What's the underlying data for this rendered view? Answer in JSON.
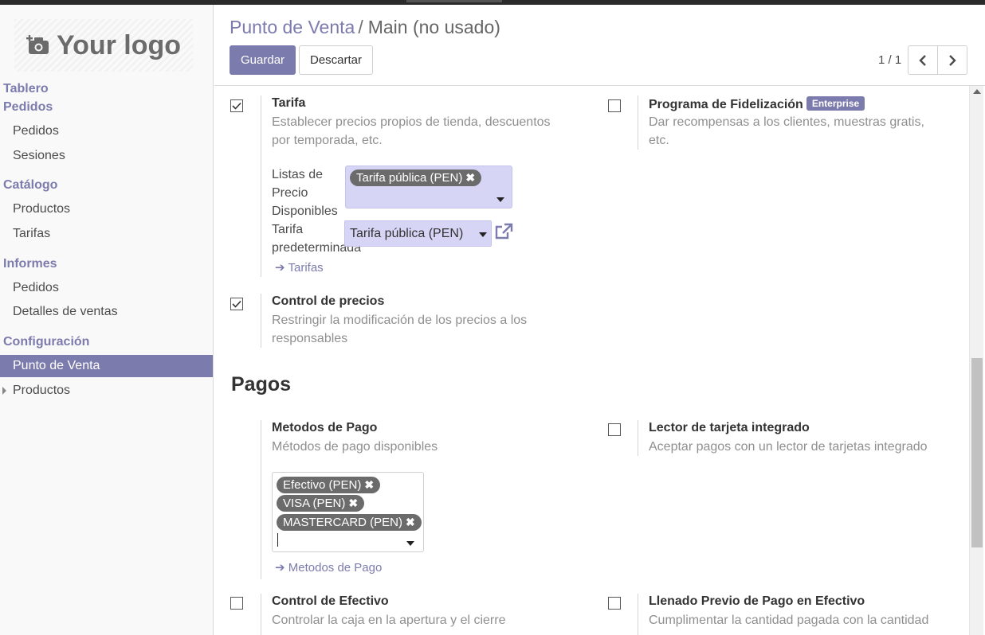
{
  "sidebar": {
    "logo_text": "Your logo",
    "sections": [
      {
        "title": "Tablero",
        "items": []
      },
      {
        "title": "Pedidos",
        "items": [
          "Pedidos",
          "Sesiones"
        ]
      },
      {
        "title": "Catálogo",
        "items": [
          "Productos",
          "Tarifas"
        ]
      },
      {
        "title": "Informes",
        "items": [
          "Pedidos",
          "Detalles de ventas"
        ]
      },
      {
        "title": "Configuración",
        "items": [
          "Punto de Venta",
          "Productos"
        ]
      }
    ],
    "active_item": "Punto de Venta"
  },
  "header": {
    "breadcrumb_parent": "Punto de Venta",
    "breadcrumb_sep": "/",
    "breadcrumb_current": "Main (no usado)",
    "save_label": "Guardar",
    "discard_label": "Descartar",
    "pager_value": "1 / 1"
  },
  "settings": {
    "tarifa": {
      "title": "Tarifa",
      "desc": "Establecer precios propios de tienda, descuentos por temporada, etc.",
      "checked": true,
      "lists_label": "Listas de Precio Disponibles",
      "lists_tags": [
        "Tarifa pública (PEN)"
      ],
      "default_label": "Tarifa predeterminada",
      "default_value": "Tarifa pública (PEN)",
      "link": "Tarifas"
    },
    "fidelizacion": {
      "title": "Programa de Fidelización",
      "badge": "Enterprise",
      "desc": "Dar recompensas a los clientes, muestras gratis, etc.",
      "checked": false
    },
    "control_precios": {
      "title": "Control de precios",
      "desc": "Restringir la modificación de los precios a los responsables",
      "checked": true
    }
  },
  "pagos": {
    "heading": "Pagos",
    "metodos": {
      "title": "Metodos de Pago",
      "desc": "Métodos de pago disponibles",
      "tags": [
        "Efectivo (PEN)",
        "VISA (PEN)",
        "MASTERCARD (PEN)"
      ],
      "link": "Metodos de Pago"
    },
    "lector": {
      "title": "Lector de tarjeta integrado",
      "desc": "Aceptar pagos con un lector de tarjetas integrado",
      "checked": false
    },
    "control_efectivo": {
      "title": "Control de Efectivo",
      "desc": "Controlar la caja en la apertura y el cierre",
      "checked": false
    },
    "llenado": {
      "title": "Llenado Previo de Pago en Efectivo",
      "desc": "Cumplimentar la cantidad pagada con la cantidad",
      "checked": false
    }
  },
  "colors": {
    "accent": "#7c7bad",
    "tag_bg": "#6b6b6b",
    "field_bg": "#d6d5f5"
  }
}
